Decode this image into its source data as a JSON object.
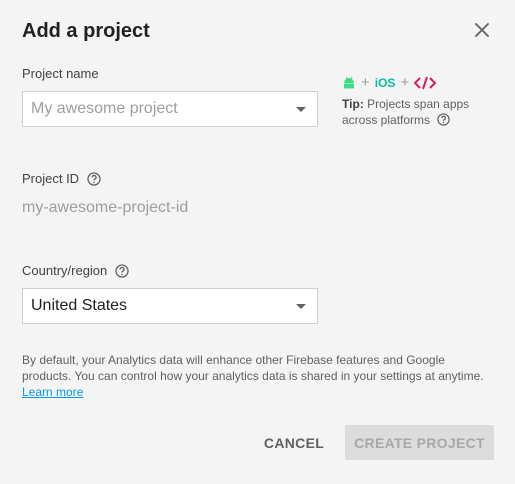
{
  "dialog": {
    "title": "Add a project"
  },
  "project_name": {
    "label": "Project name",
    "placeholder": "My awesome project"
  },
  "platforms": {
    "plus": "+",
    "ios": "iOS",
    "icons": [
      "android-icon",
      "ios-icon",
      "web-code-icon"
    ]
  },
  "tip": {
    "bold": "Tip:",
    "text": " Projects span apps across platforms"
  },
  "project_id": {
    "label": "Project ID",
    "value": "my-awesome-project-id"
  },
  "country": {
    "label": "Country/region",
    "value": "United States"
  },
  "disclaimer": {
    "text": "By default, your Analytics data will enhance other Firebase features and Google products. You can control how your analytics data is shared in your settings at anytime.",
    "link": "Learn more"
  },
  "actions": {
    "cancel": "CANCEL",
    "create": "CREATE PROJECT"
  },
  "colors": {
    "android": "#3ddc84",
    "ios": "#00bfa5",
    "web": "#d81b60",
    "link": "#039be5",
    "disabled_button": "#dcdcdc"
  }
}
